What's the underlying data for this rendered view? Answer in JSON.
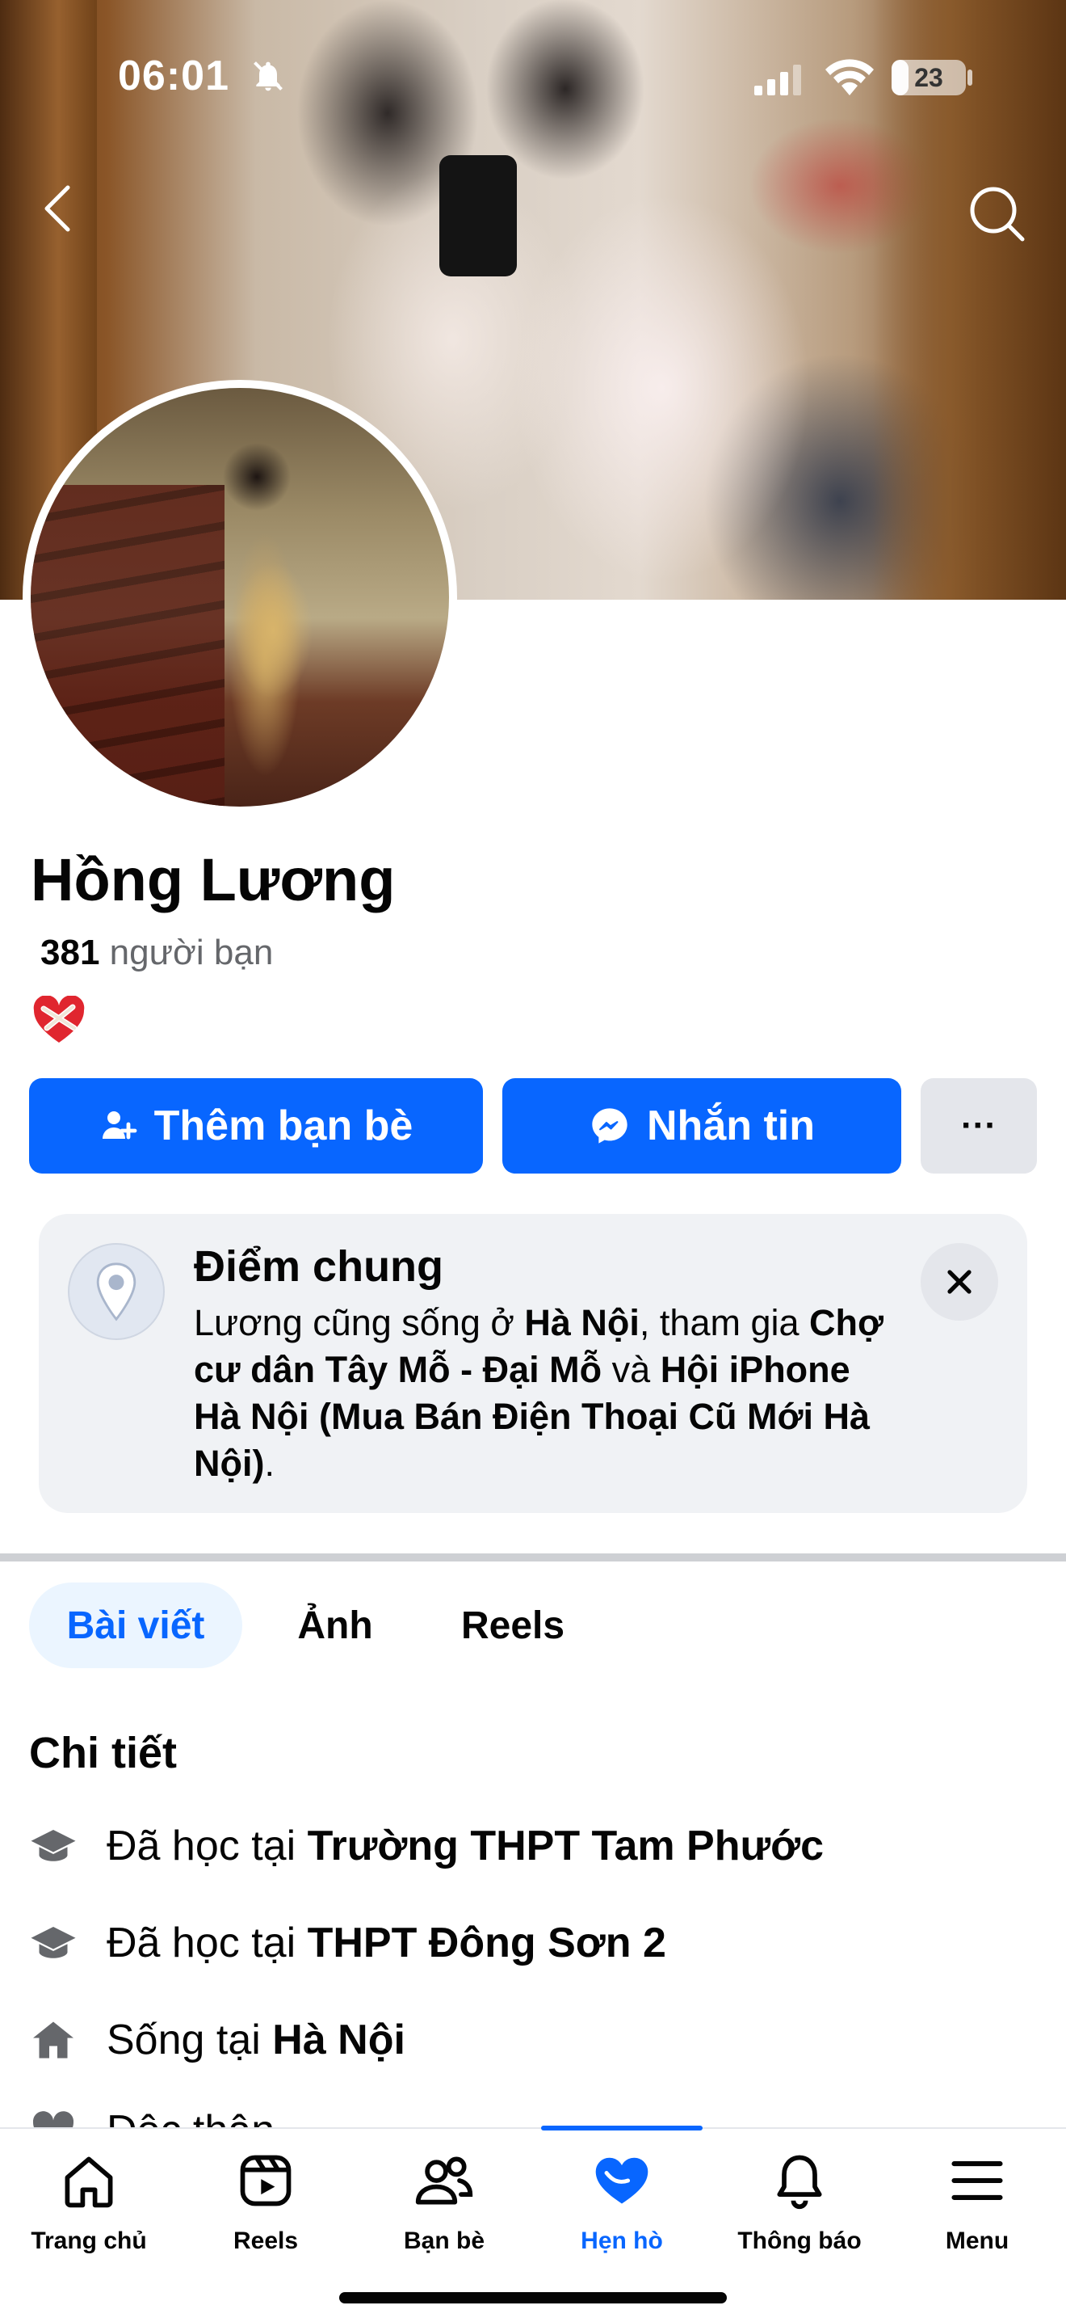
{
  "status_bar": {
    "time": "06:01",
    "battery_label": "23",
    "battery_level": 0.23
  },
  "profile": {
    "name": "Hồng Lương",
    "friends_count": "381",
    "friends_label": "người bạn",
    "bio_emoji": "❤️‍🩹"
  },
  "actions": {
    "add_friend_label": "Thêm bạn bè",
    "message_label": "Nhắn tin",
    "more_label": "···"
  },
  "common": {
    "title": "Điểm chung",
    "parts": {
      "p1": "Lương cũng sống ở ",
      "b1": "Hà Nội",
      "p2": ", tham gia ",
      "b2": "Chợ cư dân Tây Mỗ - Đại Mỗ",
      "p3": " và ",
      "b3": "Hội iPhone Hà Nội (Mua Bán Điện Thoại Cũ Mới Hà Nội)",
      "p4": "."
    }
  },
  "tabs": [
    {
      "label": "Bài viết",
      "active": true
    },
    {
      "label": "Ảnh",
      "active": false
    },
    {
      "label": "Reels",
      "active": false
    }
  ],
  "details": {
    "title": "Chi tiết",
    "items": [
      {
        "prefix": "Đã học tại ",
        "value": "Trường THPT Tam Phước",
        "icon": "graduation-cap-icon"
      },
      {
        "prefix": "Đã học tại ",
        "value": "THPT Đông Sơn 2",
        "icon": "graduation-cap-icon"
      },
      {
        "prefix": "Sống tại ",
        "value": "Hà Nội",
        "icon": "home-icon"
      },
      {
        "prefix": "Độc thân",
        "value": "",
        "icon": "heart-icon"
      }
    ]
  },
  "nav": [
    {
      "label": "Trang chủ",
      "icon": "home-icon"
    },
    {
      "label": "Reels",
      "icon": "reels-icon"
    },
    {
      "label": "Bạn bè",
      "icon": "friends-icon"
    },
    {
      "label": "Hẹn hò",
      "icon": "dating-heart-icon",
      "active": true
    },
    {
      "label": "Thông báo",
      "icon": "bell-icon"
    },
    {
      "label": "Menu",
      "icon": "menu-icon"
    }
  ],
  "colors": {
    "accent": "#0866ff",
    "card_bg": "#f0f2f5",
    "muted_text": "#65676b"
  }
}
